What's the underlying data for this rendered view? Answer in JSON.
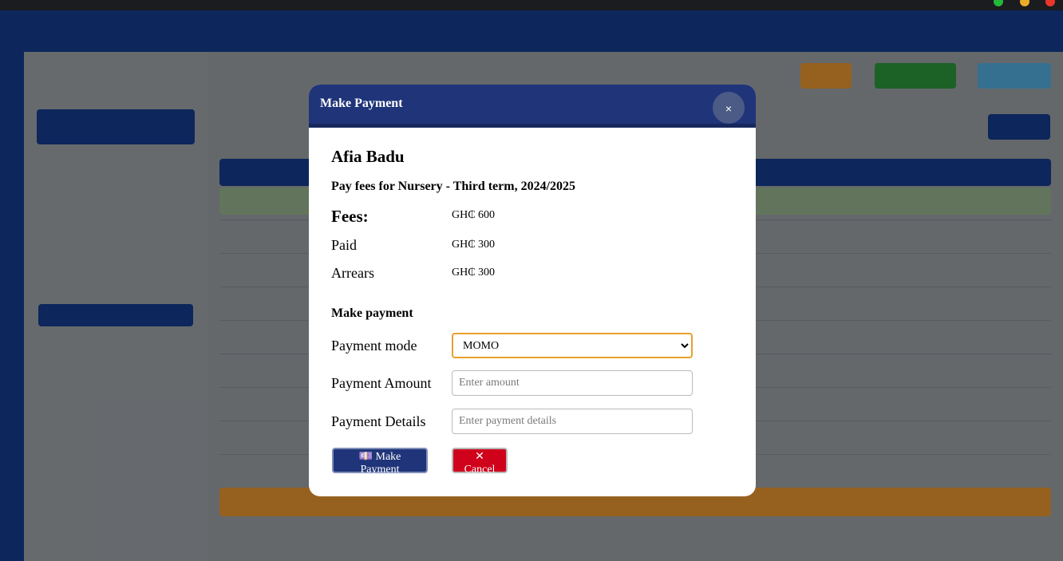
{
  "window": {
    "controls": [
      {
        "name": "maximize",
        "color": "#28c840"
      },
      {
        "name": "minimize",
        "color": "#febc2e"
      },
      {
        "name": "close",
        "color": "#ff3b30"
      }
    ]
  },
  "modal": {
    "title": "Make Payment",
    "close_label": "×",
    "student_name": "Afia Badu",
    "term_line": "Pay fees for Nursery - Third term, 2024/2025",
    "fees_label": "Fees:",
    "fees_value": "GH₵ 600",
    "paid_label": "Paid",
    "paid_value": "GH₵ 300",
    "arrears_label": "Arrears",
    "arrears_value": "GH₵ 300",
    "section_title": "Make payment",
    "payment_mode_label": "Payment mode",
    "payment_mode_value": "MOMO",
    "payment_amount_label": "Payment Amount",
    "payment_amount_placeholder": "Enter amount",
    "payment_details_label": "Payment Details",
    "payment_details_placeholder": "Enter payment details",
    "submit_label": "Make Payment",
    "submit_icon": "money-icon",
    "cancel_label": "Cancel",
    "cancel_icon": "close-icon"
  },
  "colors": {
    "brand": "#1f3479",
    "accent": "#e7a12b",
    "danger": "#d0021b"
  }
}
